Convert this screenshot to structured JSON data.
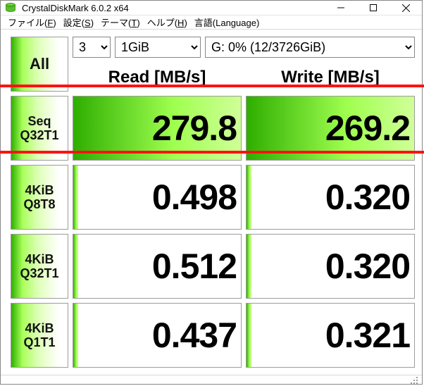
{
  "window": {
    "title": "CrystalDiskMark 6.0.2 x64"
  },
  "menu": {
    "file": {
      "label": "ファイル",
      "key": "F"
    },
    "settings": {
      "label": "設定",
      "key": "S"
    },
    "theme": {
      "label": "テーマ",
      "key": "T"
    },
    "help": {
      "label": "ヘルプ",
      "key": "H"
    },
    "lang": {
      "label": "言語(Language)"
    }
  },
  "controls": {
    "all": "All",
    "runs_value": "3",
    "size_value": "1GiB",
    "drive_value": "G: 0% (12/3726GiB)"
  },
  "headers": {
    "read": "Read [MB/s]",
    "write": "Write [MB/s]"
  },
  "tests": [
    {
      "l1": "Seq",
      "l2": "Q32T1",
      "read": "279.8",
      "write": "269.2",
      "read_fill": 100,
      "write_fill": 100,
      "highlight": true
    },
    {
      "l1": "4KiB",
      "l2": "Q8T8",
      "read": "0.498",
      "write": "0.320",
      "read_fill": 3,
      "write_fill": 3
    },
    {
      "l1": "4KiB",
      "l2": "Q32T1",
      "read": "0.512",
      "write": "0.320",
      "read_fill": 3,
      "write_fill": 3
    },
    {
      "l1": "4KiB",
      "l2": "Q1T1",
      "read": "0.437",
      "write": "0.321",
      "read_fill": 3,
      "write_fill": 3
    }
  ]
}
